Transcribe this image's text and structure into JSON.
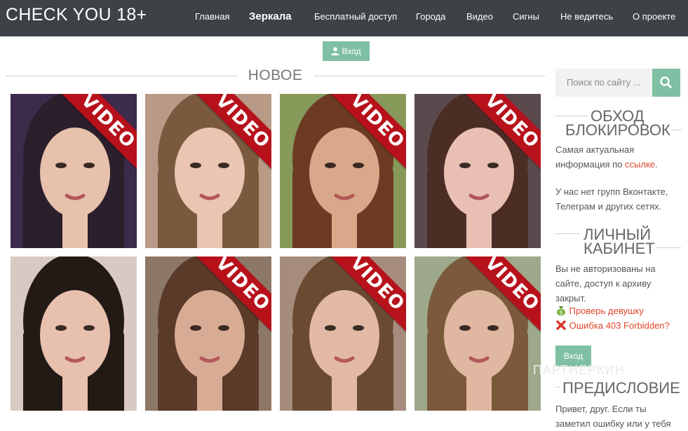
{
  "header": {
    "logo": "CHECK YOU 18+",
    "nav": [
      "Главная",
      "Зеркала",
      "Бесплатный доступ",
      "Города",
      "Видео",
      "Сигны",
      "Не ведитесь",
      "О проекте"
    ],
    "active_index": 1
  },
  "login": {
    "label": "Вход",
    "icon": "user-icon"
  },
  "section": {
    "title": "НОВОЕ"
  },
  "grid": {
    "ribbon_label": "VIDEO",
    "ribbon_color": "#b7121b",
    "cards": [
      {
        "video": true,
        "skin": "#e7c1ac",
        "hair": "#2a1f2a",
        "bg": "#3c2b4a"
      },
      {
        "video": true,
        "skin": "#e9c5b2",
        "hair": "#7a5a3e",
        "bg": "#b89a86"
      },
      {
        "video": true,
        "skin": "#d9a88a",
        "hair": "#6d3b24",
        "bg": "#879a5a"
      },
      {
        "video": true,
        "skin": "#e8bfb2",
        "hair": "#4b2d25",
        "bg": "#5a4a4e"
      },
      {
        "video": false,
        "skin": "#e7c0ae",
        "hair": "#231a16",
        "bg": "#d8c9c2"
      },
      {
        "video": true,
        "skin": "#d8ab95",
        "hair": "#5a3a28",
        "bg": "#8d7766"
      },
      {
        "video": true,
        "skin": "#e2b9a5",
        "hair": "#6b4a32",
        "bg": "#a58c7c"
      },
      {
        "video": true,
        "skin": "#e0b7a1",
        "hair": "#7b5a3c",
        "bg": "#9ea88a"
      }
    ]
  },
  "sidebar": {
    "search_placeholder": "Поиск по сайту ...",
    "bypass_title_1": "ОБХОД",
    "bypass_title_2": "БЛОКИРОВОК",
    "bypass_text_1": "Самая актуальная",
    "bypass_text_2": "информация по",
    "bypass_link": "ссылке",
    "bypass_text_3": ".",
    "groups_text_1": "У нас нет групп Вконтакте,",
    "groups_text_2": "Телеграм и других сетях.",
    "cabinet_title_1": "ЛИЧНЫЙ",
    "cabinet_title_2": "КАБИНЕТ",
    "cabinet_text_1": "Вы не авторизованы на",
    "cabinet_text_2": "сайте, доступ к архиву",
    "cabinet_text_3": "закрыт.",
    "check_link": "Проверь девушку",
    "error_link": "Ошибка 403 Forbidden?",
    "login_button": "Вход",
    "watermark": "ПАРТНЕРКИН",
    "preface_title": "ПРЕДИСЛОВИЕ",
    "preface_text_1": "Привет, друг. Если ты",
    "preface_text_2": "заметил ошибку или у тебя"
  },
  "colors": {
    "header_bg": "#3d4246",
    "accent": "#7fbfa3",
    "link": "#e0452b"
  }
}
